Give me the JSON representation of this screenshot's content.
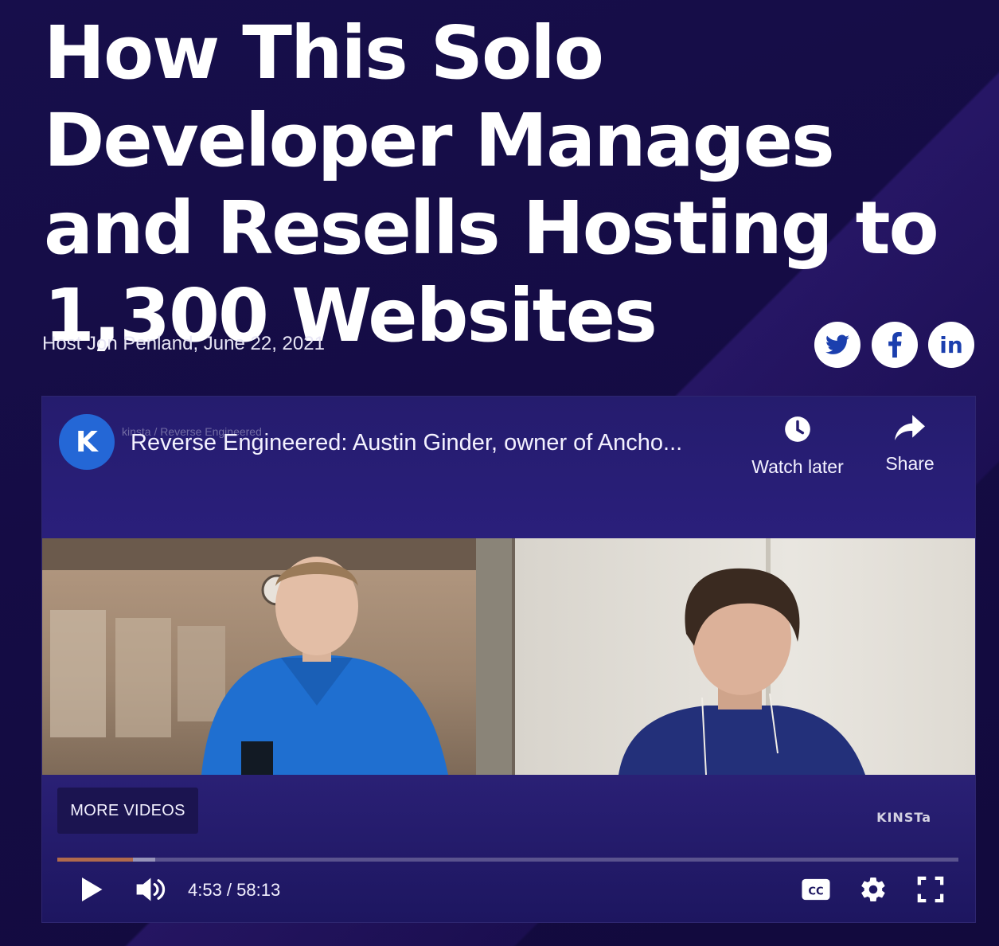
{
  "article": {
    "headline": "How This Solo Developer Manages and Resells Hosting to 1,300 Websites",
    "byline": "Host Jon Penland, June 22, 2021"
  },
  "social": [
    {
      "name": "twitter-share-button",
      "icon": "twitter-icon"
    },
    {
      "name": "facebook-share-button",
      "icon": "facebook-icon",
      "glyph": "f"
    },
    {
      "name": "linkedin-share-button",
      "icon": "linkedin-icon",
      "glyph": "in"
    }
  ],
  "player": {
    "channel_avatar_letter": "K",
    "channel_ghost": "kinsta / Reverse Engineered",
    "title": "Reverse Engineered: Austin Ginder, owner of Ancho...",
    "watch_later_label": "Watch later",
    "share_label": "Share",
    "more_videos_label": "MORE VIDEOS",
    "watermark": "KINSTa",
    "time_display": "4:53 / 58:13",
    "current_time": "4:53",
    "duration": "58:13",
    "progress_played_fraction": 0.084,
    "progress_buffered_fraction": 0.109,
    "controls": [
      "play-icon",
      "volume-icon",
      "closed-captions-icon",
      "settings-gear-icon",
      "fullscreen-icon"
    ]
  },
  "colors": {
    "background": "#150d45",
    "accent_blue": "#2467d6",
    "icon_blue": "#1b3fae",
    "progress_played": "#b06a4c"
  }
}
